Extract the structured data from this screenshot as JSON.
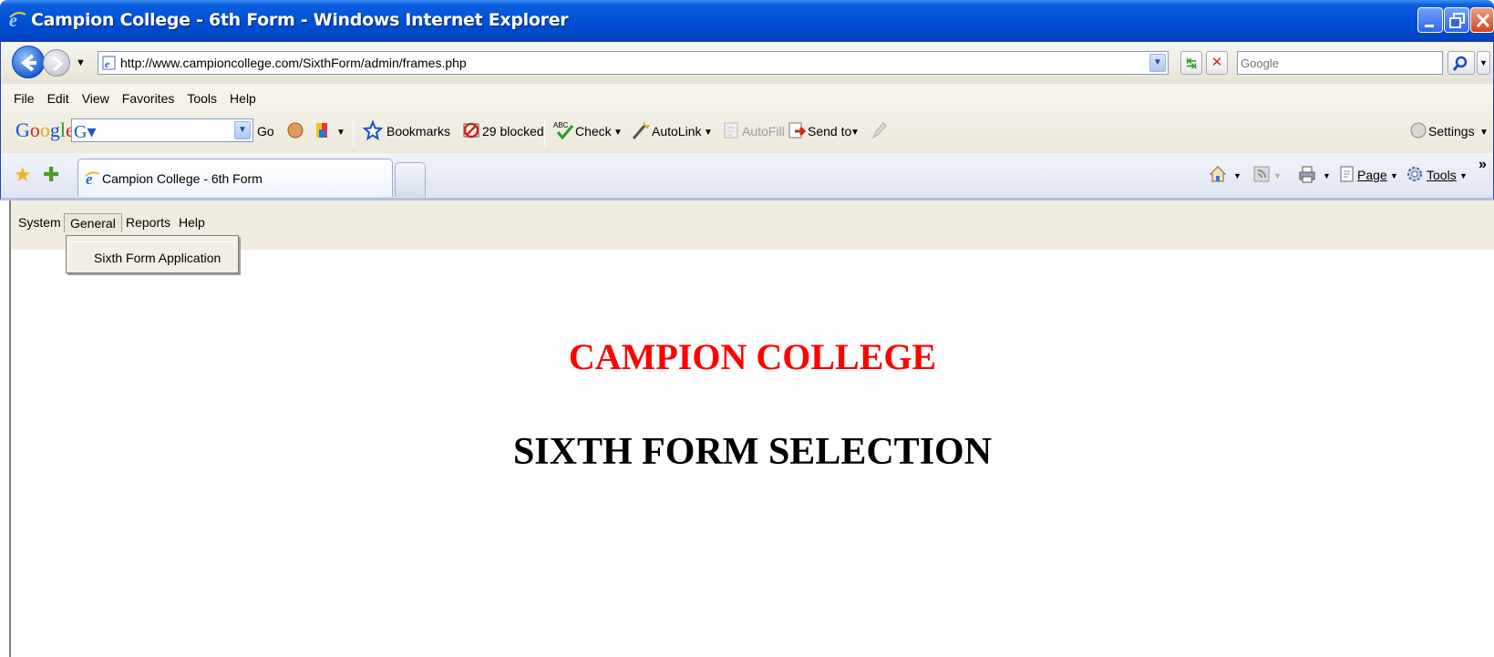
{
  "window": {
    "title": "Campion College - 6th Form - Windows Internet Explorer"
  },
  "address_bar": {
    "url": "http://www.campioncollege.com/SixthForm/admin/frames.php",
    "search_placeholder": "Google"
  },
  "menu": {
    "items": [
      "File",
      "Edit",
      "View",
      "Favorites",
      "Tools",
      "Help"
    ]
  },
  "google_toolbar": {
    "logo": "Google",
    "go_label": "Go",
    "bookmarks_label": "Bookmarks",
    "blocked_label": "29 blocked",
    "check_label": "Check",
    "autolink_label": "AutoLink",
    "autofill_label": "AutoFill",
    "sendto_label": "Send to",
    "settings_label": "Settings"
  },
  "tabs": {
    "active_label": "Campion College - 6th Form"
  },
  "command_bar": {
    "page_label": "Page",
    "tools_label": "Tools"
  },
  "app": {
    "menu": [
      "System",
      "General",
      "Reports",
      "Help"
    ],
    "open_menu": "General",
    "dropdown_items": [
      "Sixth Form Application"
    ],
    "heading": "CAMPION COLLEGE",
    "subheading": "SIXTH FORM SELECTION"
  },
  "colors": {
    "heading": "#ff0000",
    "titlebar": "#0050d6"
  }
}
